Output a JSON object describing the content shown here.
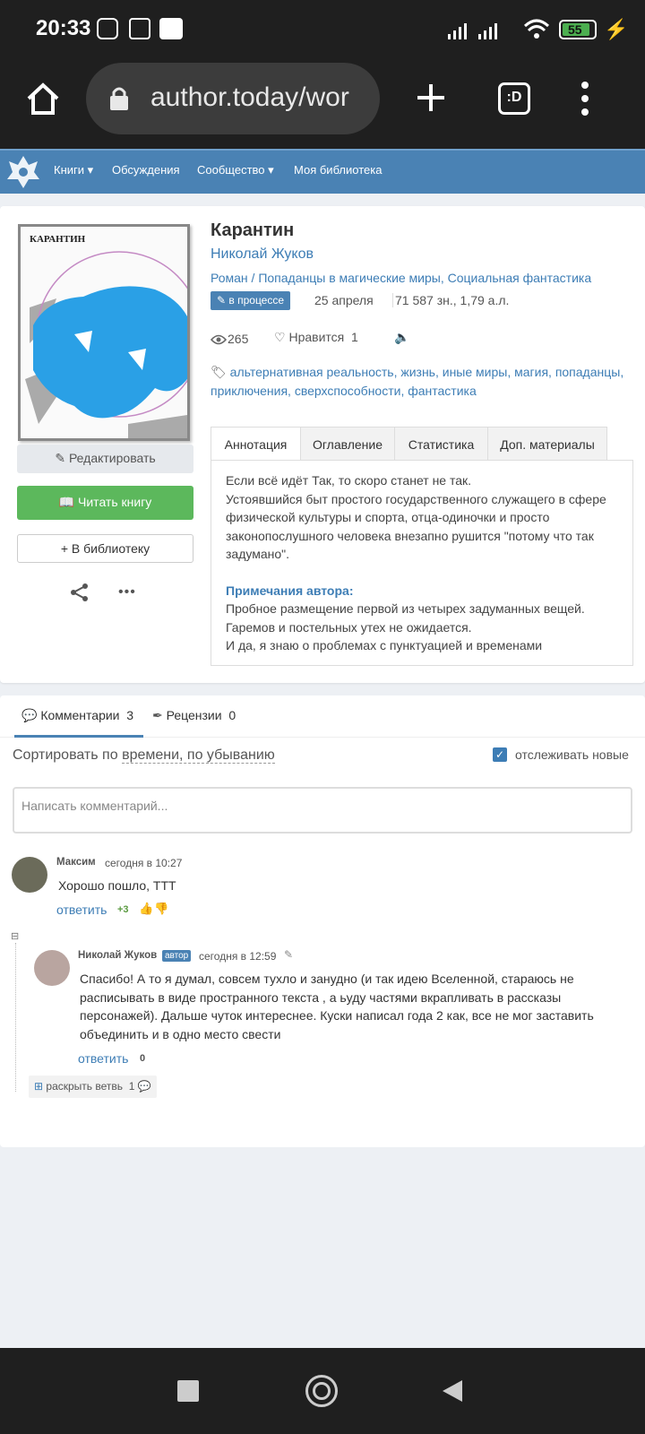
{
  "status": {
    "time": "20:33",
    "battery": "55"
  },
  "browser": {
    "url": "author.today/wor"
  },
  "nav": {
    "items": [
      {
        "label": "Книги"
      },
      {
        "label": "Обсуждения"
      },
      {
        "label": "Сообщество"
      },
      {
        "label": "Моя библиотека"
      }
    ]
  },
  "book": {
    "cover_title": "КАРАНТИН",
    "title": "Карантин",
    "author": "Николай Жуков",
    "genres": "Роман / Попаданцы в магические миры, Социальная фантастика",
    "status_badge": "в процессе",
    "date": "25 апреля",
    "size": "71 587 зн., 1,79 а.л.",
    "views": "265",
    "likes_label": "Нравится",
    "likes": "1",
    "tags": "альтернативная реальность, жизнь, иные миры, магия, попаданцы, приключения, сверхспособности, фантастика",
    "edit_button": "Редактировать",
    "read_button": "Читать книгу",
    "library_button": "В библиотеку",
    "colors": {
      "read": "#5cb85c",
      "link": "#3d7db5",
      "badge": "#4a82b4",
      "nav": "#4a82b4"
    }
  },
  "tabs": [
    {
      "label": "Аннотация"
    },
    {
      "label": "Оглавление"
    },
    {
      "label": "Статистика"
    },
    {
      "label": "Доп. материалы"
    }
  ],
  "annotation": {
    "line1": "Если всё идёт Так, то скоро станет не так.",
    "para2": "Устоявшийся быт простого государственного служащего в сфере физической культуры и спорта, отца-одиночки и просто законопослушного человека внезапно рушится \"потому что так задумано\".",
    "notes_title": "Примечания автора:",
    "notes1": "Пробное размещение первой из четырех задуманных вещей.",
    "notes2": "Гаремов и постельных утех не ожидается.",
    "notes3": "И да, я знаю о проблемах с пунктуацией и временами"
  },
  "comments_section": {
    "tab_comments": "Комментарии",
    "tab_comments_count": "3",
    "tab_reviews": "Рецензии",
    "tab_reviews_count": "0",
    "sort_prefix": "Сортировать по",
    "sort_value": "времени, по убыванию",
    "track_label": "отслеживать новые",
    "input_placeholder": "Написать комментарий...",
    "comments": [
      {
        "author": "Максим",
        "time": "сегодня в 10:27",
        "text": "Хорошо пошло, ТТТ",
        "reply": "ответить",
        "score": "+3"
      },
      {
        "author": "Николай Жуков",
        "badge": "автор",
        "time": "сегодня в 12:59",
        "text": "Спасибо! А то я думал, совсем тухло и занудно (и так идею Вселенной, стараюсь не расписывать в виде пространного текста , а ьуду частями вкрапливать в рассказы персонажей). Дальше чуток интереснее. Куски написал года 2 как,  все не мог заставить объединить и в одно место свести",
        "reply": "ответить",
        "score": "0"
      }
    ],
    "expand_label": "раскрыть ветвь",
    "expand_count": "1"
  }
}
